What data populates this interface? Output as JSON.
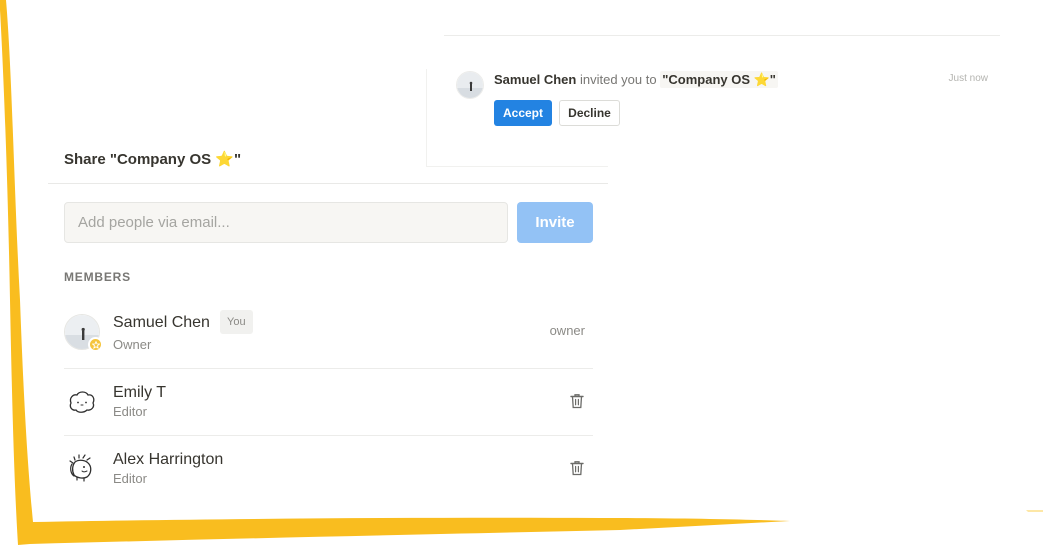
{
  "notification": {
    "sender": "Samuel Chen",
    "message": "invited you to",
    "document": "\"Company OS ⭐\"",
    "time": "Just now",
    "accept_label": "Accept",
    "decline_label": "Decline"
  },
  "share": {
    "title": "Share \"Company OS ⭐\"",
    "input_placeholder": "Add people via email...",
    "invite_label": "Invite",
    "members_heading": "MEMBERS"
  },
  "members": [
    {
      "name": "Samuel Chen",
      "badge": "You",
      "role": "Owner",
      "permission": "owner",
      "avatar": "photo-avatar"
    },
    {
      "name": "Emily T",
      "role": "Editor",
      "avatar": "doodle-face-avatar"
    },
    {
      "name": "Alex Harrington",
      "role": "Editor",
      "avatar": "doodle-hedgehog-avatar"
    }
  ],
  "colors": {
    "frame": "#F9BD1F",
    "accept": "#2383E2",
    "invite_disabled": "#93C2F5",
    "owner_badge": "#F5C53D"
  },
  "icons": [
    "star-icon",
    "trash-icon",
    "owner-star-badge-icon"
  ]
}
